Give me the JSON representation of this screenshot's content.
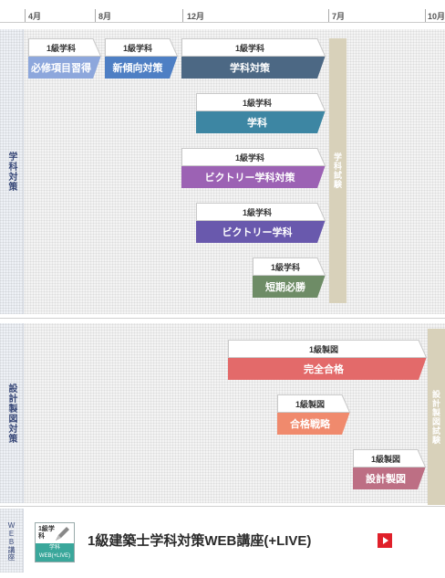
{
  "months": [
    {
      "label": "4月"
    },
    {
      "label": "8月"
    },
    {
      "label": "12月"
    },
    {
      "label": "7月"
    },
    {
      "label": "10月"
    }
  ],
  "sections": {
    "gakka": {
      "label": "学科対策"
    },
    "seizu": {
      "label": "設計製図対策"
    },
    "web": {
      "label": "WEB講座"
    }
  },
  "exams": {
    "gakka": "学科試験",
    "seizu": "設計製図試験"
  },
  "courses": [
    {
      "level": "1級学科",
      "name": "必修項目習得",
      "color": "#8da7dc"
    },
    {
      "level": "1級学科",
      "name": "新傾向対策",
      "color": "#4e7fc4"
    },
    {
      "level": "1級学科",
      "name": "学科対策",
      "color": "#4c6884"
    },
    {
      "level": "1級学科",
      "name": "学科",
      "color": "#3d86a3"
    },
    {
      "level": "1級学科",
      "name": "ビクトリー学科対策",
      "color": "#9c62b4"
    },
    {
      "level": "1級学科",
      "name": "ビクトリー学科",
      "color": "#6959ad"
    },
    {
      "level": "1級学科",
      "name": "短期必勝",
      "color": "#6e8c66"
    },
    {
      "level": "1級製図",
      "name": "完全合格",
      "color": "#e36a6a"
    },
    {
      "level": "1級製図",
      "name": "合格戦略",
      "color": "#f08a6d"
    },
    {
      "level": "1級製図",
      "name": "設計製図",
      "color": "#bd6f84"
    }
  ],
  "web": {
    "icon_top": "1級学科",
    "icon_bottom": "学科WEB(+LIVE)",
    "title": "1級建築士学科対策WEB講座(+LIVE)",
    "play_icon": "play-icon"
  }
}
